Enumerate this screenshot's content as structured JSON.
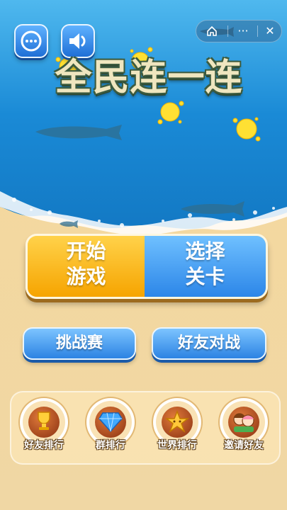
{
  "header": {
    "chat_icon": "chat-bubble-icon",
    "sound_icon": "speaker-icon",
    "capsule": {
      "home_icon": "home-icon",
      "more_label": "···",
      "close_label": "✕"
    }
  },
  "title": "全民连一连",
  "start_button": {
    "line1": "开始",
    "line2": "游戏"
  },
  "select_button": {
    "line1": "选择",
    "line2": "关卡"
  },
  "challenge_button": {
    "label": "挑战赛"
  },
  "friend_battle_button": {
    "label": "好友对战"
  },
  "rankings": [
    {
      "label": "好友排行",
      "icon": "trophy-icon"
    },
    {
      "label": "群排行",
      "icon": "diamond-icon"
    },
    {
      "label": "世界排行",
      "icon": "star-icon"
    },
    {
      "label": "邀请好友",
      "icon": "friends-icon"
    }
  ],
  "colors": {
    "sea": "#1e8fd6",
    "sand": "#f2d9a0",
    "orange": "#f6a400",
    "blue": "#2c86e8"
  }
}
